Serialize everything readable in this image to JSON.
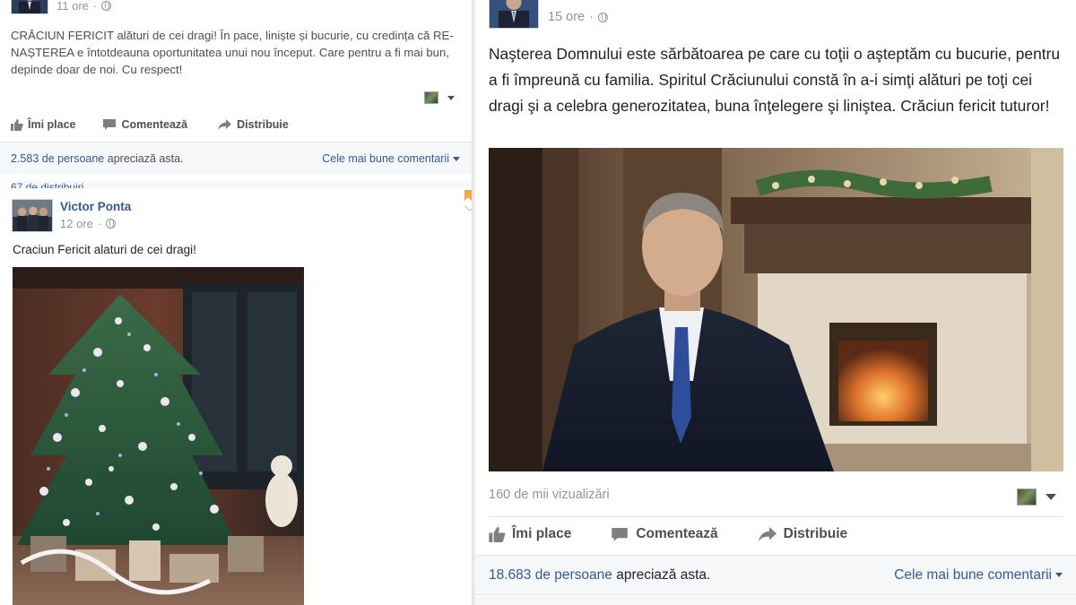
{
  "left_post_top": {
    "time": "11 ore",
    "text": "CRĂCIUN FERICIT alături de cei dragi! În pace, liniște și bucurie, cu credința că RE-NAȘTEREA e întotdeauna oportunitatea unui nou început. Care pentru a fi mai bun, depinde doar de noi. Cu respect!",
    "actions": {
      "like": "Îmi place",
      "comment": "Comentează",
      "share": "Distribuie"
    },
    "likes_count": "2.583 de persoane",
    "likes_suffix": "apreciază asta.",
    "best_comments": "Cele mai bune comentarii",
    "shares": "67 de distribuiri"
  },
  "left_post_bottom": {
    "author": "Victor Ponta",
    "time": "12 ore",
    "text": "Craciun Fericit alaturi de cei dragi!",
    "photo_icon": "christmas-tree-photo"
  },
  "right_post": {
    "time": "15 ore",
    "text": "Naşterea Domnului este sărbătoarea pe care cu toţii o aşteptăm cu bucurie, pentru a fi împreună cu familia. Spiritul Crăciunului constă în a-i simţi alături pe toţi cei dragi şi a celebra generozitatea, buna înţelegere şi liniştea. Crăciun fericit tuturor!",
    "views": "160 de mii vizualizări",
    "actions": {
      "like": "Îmi place",
      "comment": "Comentează",
      "share": "Distribuie"
    },
    "likes_count": "18.683 de persoane",
    "likes_suffix": "apreciază asta.",
    "best_comments": "Cele mai bune comentarii"
  },
  "colors": {
    "link_blue": "#365899",
    "background": "#e9ebee",
    "meta_gray": "#90949c"
  }
}
